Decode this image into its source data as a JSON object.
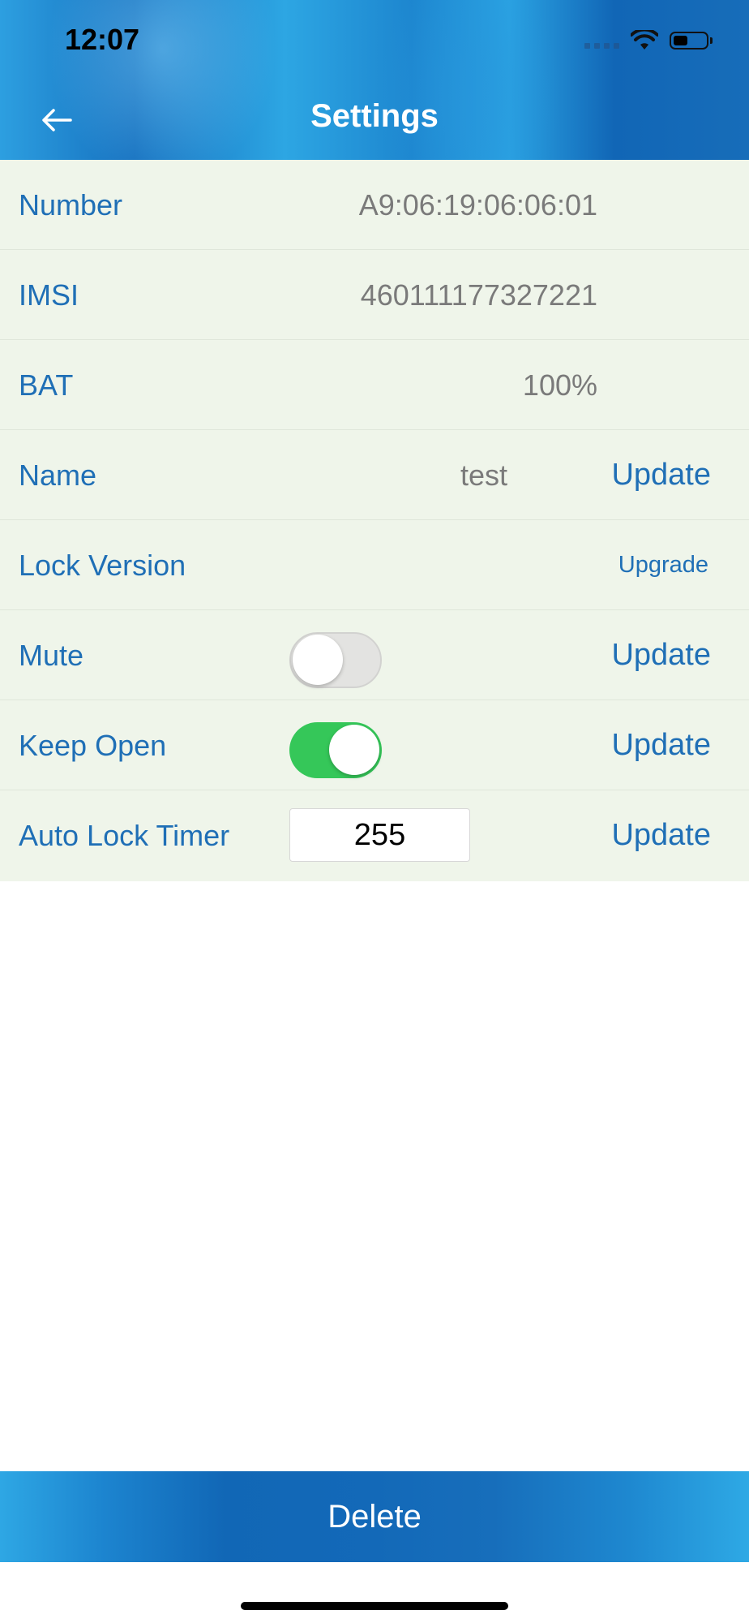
{
  "status_bar": {
    "time": "12:07",
    "icons": [
      "signal-dots-icon",
      "wifi-icon",
      "battery-icon"
    ]
  },
  "header": {
    "title": "Settings",
    "back_icon": "arrow-left-icon"
  },
  "settings": {
    "number": {
      "label": "Number",
      "value": "A9:06:19:06:06:01"
    },
    "imsi": {
      "label": "IMSI",
      "value": "460111177327221"
    },
    "bat": {
      "label": "BAT",
      "value": "100%"
    },
    "name": {
      "label": "Name",
      "value": "test",
      "action": "Update"
    },
    "lock_version": {
      "label": "Lock Version",
      "action": "Upgrade"
    },
    "mute": {
      "label": "Mute",
      "enabled": false,
      "action": "Update"
    },
    "keep_open": {
      "label": "Keep Open",
      "enabled": true,
      "action": "Update"
    },
    "auto_lock_timer": {
      "label": "Auto Lock Timer",
      "value": "255",
      "action": "Update"
    }
  },
  "footer": {
    "delete_label": "Delete"
  },
  "colors": {
    "header_blue": "#1570bf",
    "label_blue": "#1f6fb6",
    "list_background": "#eff5ea",
    "toggle_on": "#35c759",
    "value_gray": "#7a7a7a"
  }
}
